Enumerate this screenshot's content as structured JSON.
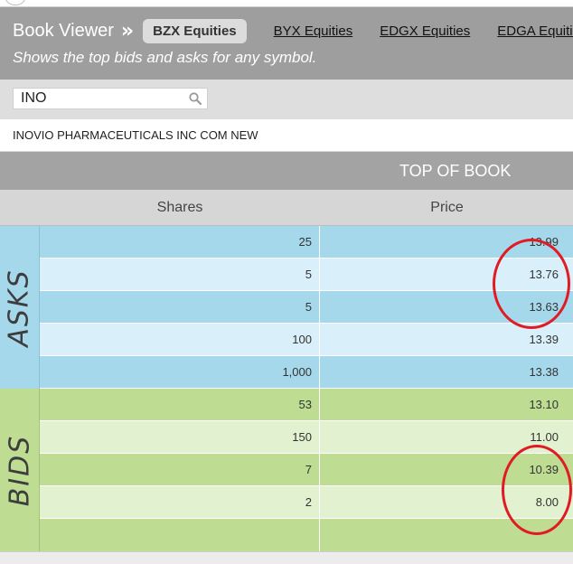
{
  "header": {
    "app_title": "Book Viewer",
    "separator": "»",
    "tabs": [
      {
        "label": "BZX Equities",
        "active": true
      },
      {
        "label": "BYX Equities",
        "active": false
      },
      {
        "label": "EDGX Equities",
        "active": false
      },
      {
        "label": "EDGA Equities",
        "active": false
      }
    ],
    "subtitle": "Shows the top bids and asks for any symbol."
  },
  "search": {
    "value": "INO",
    "icon": "search-icon"
  },
  "company": {
    "name": "INOVIO PHARMACEUTICALS INC COM NEW"
  },
  "book": {
    "title": "TOP OF BOOK",
    "columns": {
      "shares": "Shares",
      "price": "Price"
    },
    "asks_label": "ASKS",
    "bids_label": "BIDS",
    "asks": [
      {
        "shares": "25",
        "price": "13.99"
      },
      {
        "shares": "5",
        "price": "13.76"
      },
      {
        "shares": "5",
        "price": "13.63"
      },
      {
        "shares": "100",
        "price": "13.39"
      },
      {
        "shares": "1,000",
        "price": "13.38"
      }
    ],
    "bids": [
      {
        "shares": "53",
        "price": "13.10"
      },
      {
        "shares": "150",
        "price": "11.00"
      },
      {
        "shares": "7",
        "price": "10.39"
      },
      {
        "shares": "2",
        "price": "8.00"
      },
      {
        "shares": "",
        "price": ""
      }
    ]
  },
  "colors": {
    "header_bg": "#9e9e9e",
    "asks_dark": "#a6d8ec",
    "asks_light": "#d9f0fa",
    "bids_dark": "#bedd93",
    "bids_light": "#e2f1cf",
    "annotation": "#e01b24"
  }
}
